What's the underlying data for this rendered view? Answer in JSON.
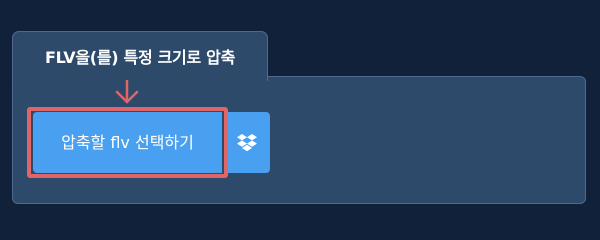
{
  "tab": {
    "title": "FLV을(를) 특정 크기로 압축"
  },
  "upload": {
    "button_label": "압축할 flv 선택하기"
  },
  "icons": {
    "arrow": "arrow-down-icon",
    "dropbox": "dropbox-icon"
  },
  "colors": {
    "background": "#11213a",
    "panel": "#2e4a6b",
    "button": "#4aa0f0",
    "highlight": "#e06566"
  }
}
